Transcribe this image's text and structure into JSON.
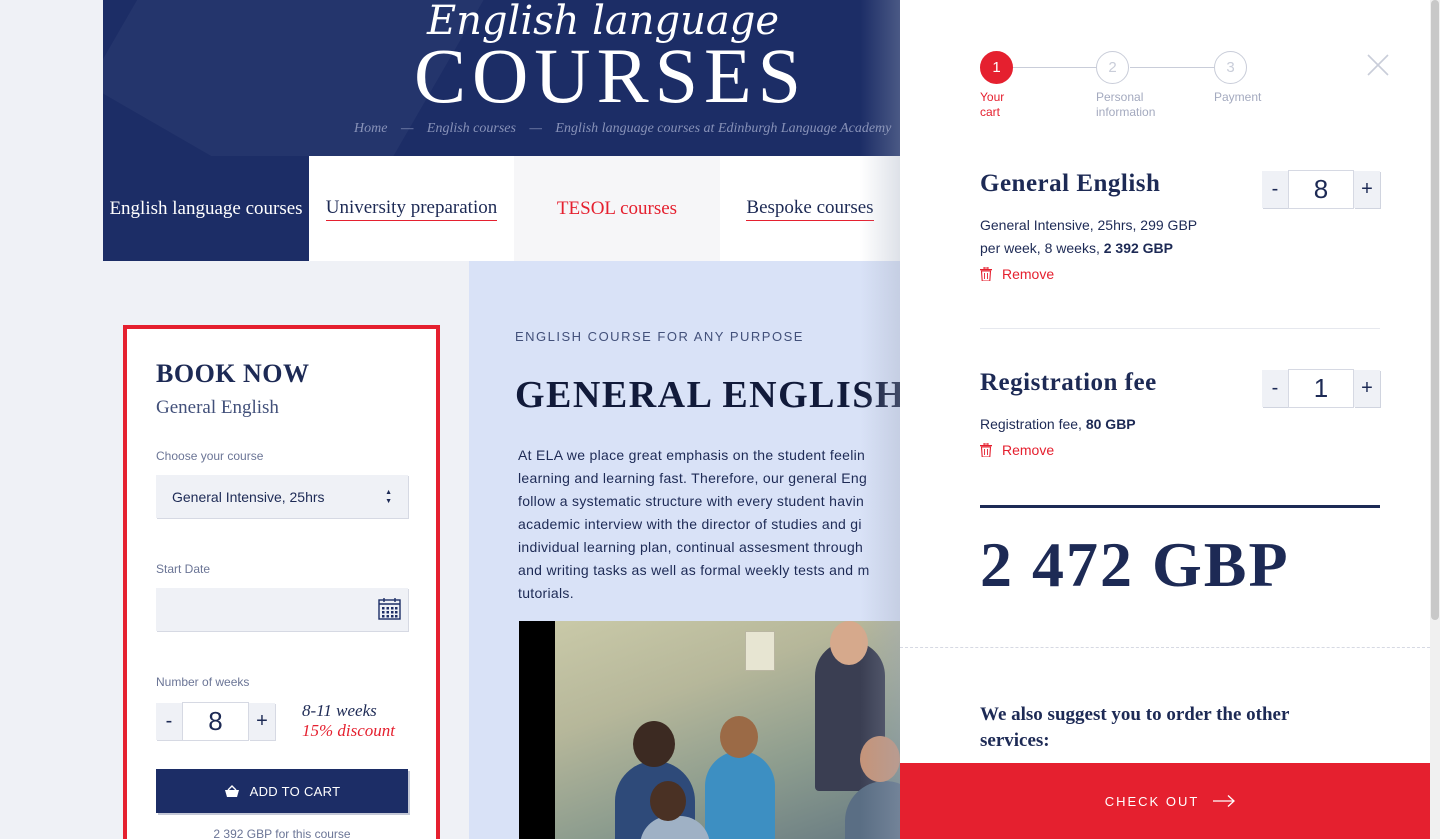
{
  "hero": {
    "subtitle": "English language",
    "title": "COURSES",
    "breadcrumb": [
      "Home",
      "English courses",
      "English language courses at Edinburgh Language Academy"
    ],
    "breadcrumb_separator": "—"
  },
  "tabs": [
    {
      "label": "English language courses",
      "state": "active"
    },
    {
      "label": "University preparation",
      "state": "link"
    },
    {
      "label": "TESOL courses",
      "state": "hover"
    },
    {
      "label": "Bespoke courses",
      "state": "link"
    }
  ],
  "book": {
    "title": "BOOK NOW",
    "course": "General English",
    "course_label": "Choose your course",
    "course_value": "General Intensive, 25hrs",
    "date_label": "Start Date",
    "date_value": "",
    "weeks_label": "Number of weeks",
    "weeks_minus": "-",
    "weeks_value": "8",
    "weeks_plus": "+",
    "discount_weeks": "8-11 weeks",
    "discount_pct": "15% discount",
    "add_to_cart": "ADD TO CART",
    "price_note": "2 392 GBP for this course"
  },
  "content": {
    "eyebrow": "ENGLISH COURSE FOR ANY PURPOSE",
    "title": "GENERAL ENGLISH",
    "body": "At ELA we place great emphasis on the student feelin\nlearning and learning fast. Therefore, our general Eng\nfollow a systematic structure with every student havin\nacademic interview with the director of studies and gi\nindividual learning plan, continual assesment through\nand writing tasks as well as formal weekly tests and m\ntutorials."
  },
  "cart": {
    "steps": [
      {
        "number": "1",
        "label": "Your\ncart",
        "active": true
      },
      {
        "number": "2",
        "label": "Personal\ninformation",
        "active": false
      },
      {
        "number": "3",
        "label": "Payment",
        "active": false
      }
    ],
    "items": [
      {
        "title": "General English",
        "desc_text": "General Intensive, 25hrs, 299 GBP per week, 8 weeks, ",
        "desc_total": "2 392 GBP",
        "quantity": "8",
        "remove": "Remove"
      },
      {
        "title": "Registration fee",
        "desc_text": "Registration fee, ",
        "desc_total": "80 GBP",
        "quantity": "1",
        "remove": "Remove"
      }
    ],
    "stepper_minus": "-",
    "stepper_plus": "+",
    "total": "2 472 GBP",
    "suggest": "We also suggest you to order the other services:",
    "checkout": "CHECK OUT"
  },
  "colors": {
    "navy": "#1c2d66",
    "accent_red": "#e5202f",
    "light_bg": "#eff1f6",
    "content_bg": "#d9e2f7"
  },
  "icons": [
    "close-icon",
    "calendar-icon",
    "basket-icon",
    "trash-icon",
    "arrow-right-icon",
    "select-arrows-icon"
  ]
}
